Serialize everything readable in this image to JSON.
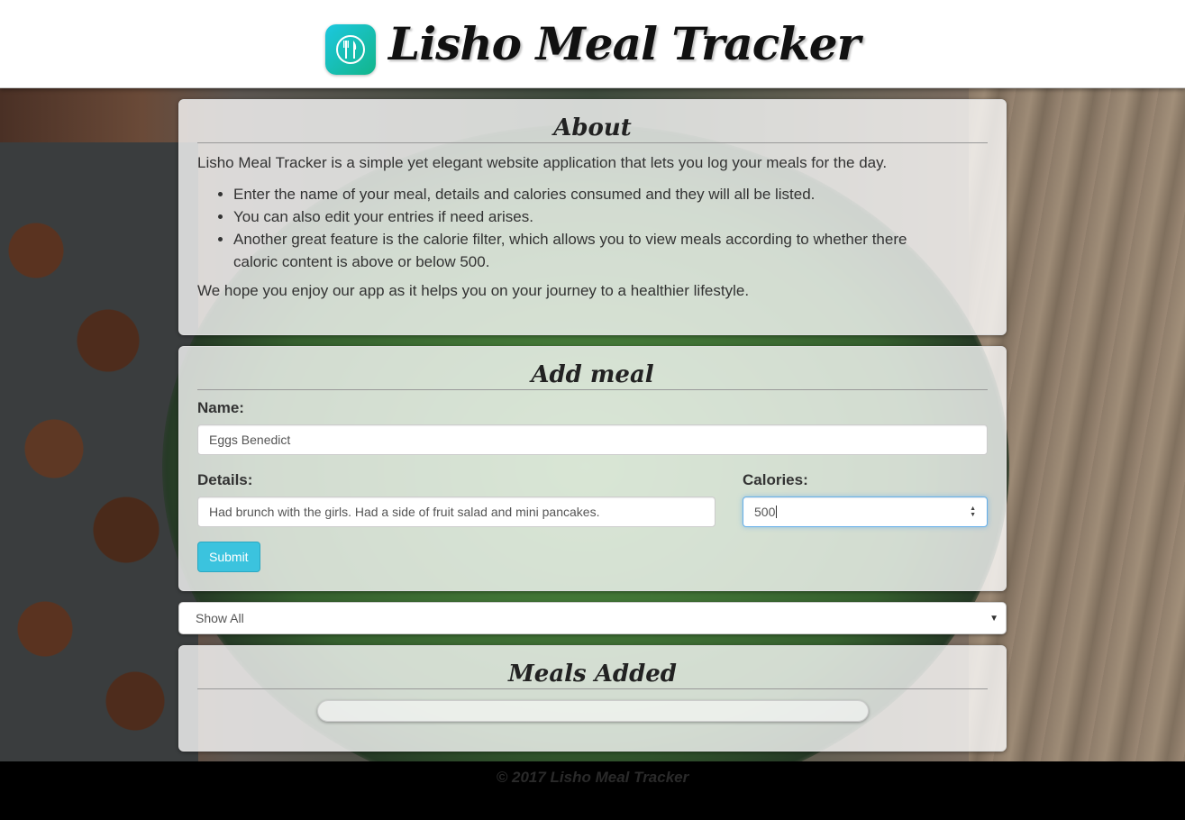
{
  "header": {
    "title": "Lisho Meal Tracker",
    "logo_icon": "fork-knife-icon"
  },
  "about": {
    "heading": "About",
    "intro": "Lisho Meal Tracker is a simple yet elegant website application that lets you log your meals for the day.",
    "bullets": [
      "Enter the name of your meal, details and calories consumed and they will all be listed.",
      "You can also edit your entries if need arises.",
      "Another great feature is the calorie filter, which allows you to view meals according to whether there caloric content is above or below 500."
    ],
    "outro": "We hope you enjoy our app as it helps you on your journey to a healthier lifestyle."
  },
  "add_meal": {
    "heading": "Add meal",
    "name_label": "Name:",
    "name_value": "Eggs Benedict",
    "details_label": "Details:",
    "details_value": "Had brunch with the girls. Had a side of fruit salad and mini pancakes.",
    "calories_label": "Calories:",
    "calories_value": "500",
    "submit_label": "Submit"
  },
  "filter": {
    "selected": "Show All"
  },
  "meals": {
    "heading": "Meals Added"
  },
  "footer": {
    "text": "© 2017 Lisho Meal Tracker"
  },
  "colors": {
    "accent": "#3bc3de",
    "logo_start": "#1cc8e0",
    "logo_end": "#13b58a",
    "footer_bg": "#000000"
  }
}
